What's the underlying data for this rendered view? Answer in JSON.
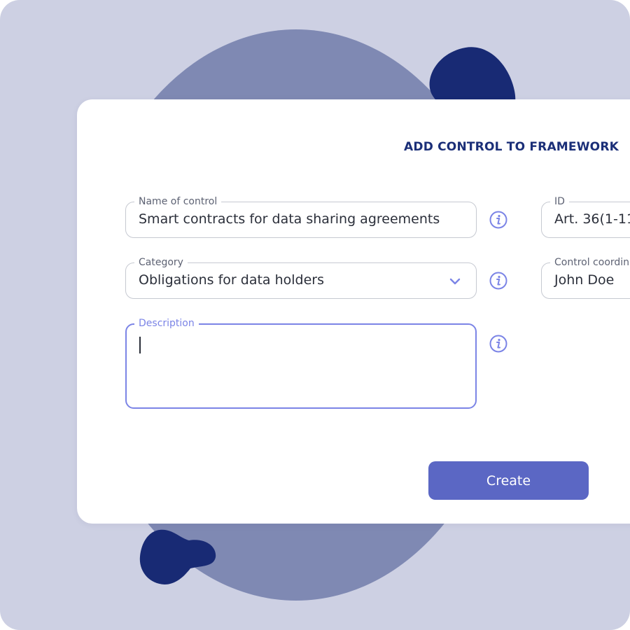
{
  "form": {
    "title": "ADD CONTROL TO FRAMEWORK",
    "name_of_control": {
      "label": "Name of control",
      "value": "Smart contracts for data sharing agreements"
    },
    "id": {
      "label": "ID",
      "value": "Art. 36(1-11"
    },
    "category": {
      "label": "Category",
      "value": "Obligations for data holders"
    },
    "control_coordinator": {
      "label": "Control coordin",
      "value": "John Doe"
    },
    "description": {
      "label": "Description",
      "value": ""
    },
    "create_button_label": "Create"
  },
  "icons": {
    "info": "info-icon",
    "dropdown": "chevron-down-icon"
  },
  "colors": {
    "background": "#cdd0e3",
    "blob_light": "#7f89b3",
    "blob_dark": "#182a74",
    "title": "#1b2f78",
    "accent": "#7b84e6",
    "button": "#5b67c4"
  }
}
